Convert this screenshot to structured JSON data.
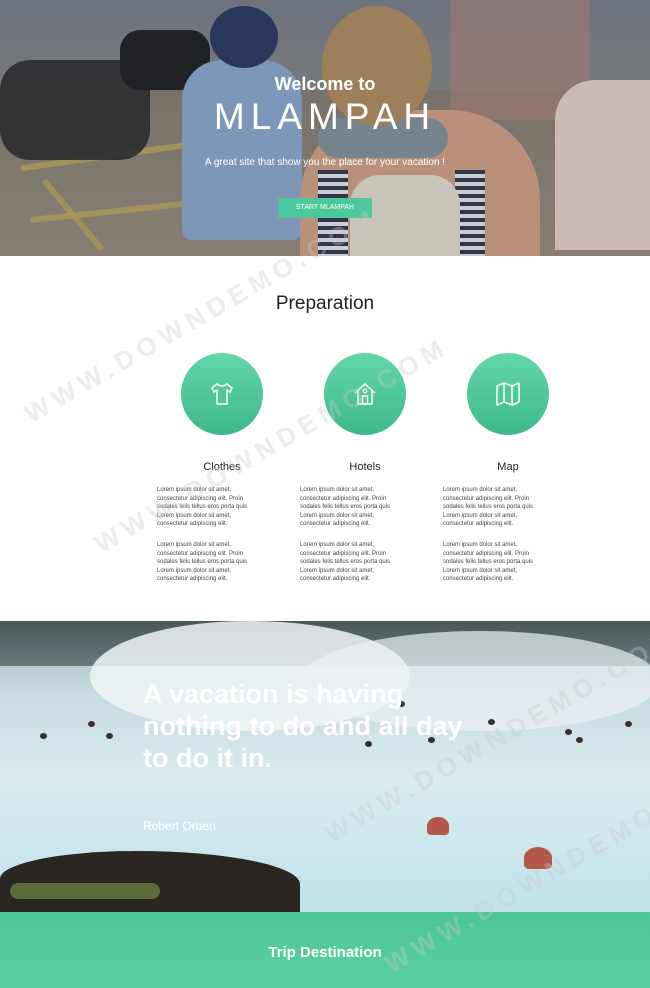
{
  "hero": {
    "welcome": "Welcome to",
    "brand": "MLAMPAH",
    "subtitle": "A great site that show you the place for your vacation !",
    "button_label": "START MLAMPAH"
  },
  "preparation": {
    "title": "Preparation",
    "features": [
      {
        "icon": "shirt-icon",
        "title": "Clothes",
        "para1": "Lorem ipsum dolor sit amet, consectetur adipiscing elit. Proin sodales felis tellus eros porta quis Lorem ipsum dolor sit amet, consectetur adipiscing elit.",
        "para2": "Lorem ipsum dolor sit amet, consectetur adipiscing elit. Proin sodales felis tellus eros porta quis Lorem ipsum dolor sit amet, consectetur adipiscing elit."
      },
      {
        "icon": "house-icon",
        "title": "Hotels",
        "para1": "Lorem ipsum dolor sit amet, consectetur adipiscing elit. Proin sodales felis tellus eros porta quis Lorem ipsum dolor sit amet, consectetur adipiscing elit.",
        "para2": "Lorem ipsum dolor sit amet, consectetur adipiscing elit. Proin sodales felis tellus eros porta quis Lorem ipsum dolor sit amet, consectetur adipiscing elit."
      },
      {
        "icon": "map-icon",
        "title": "Map",
        "para1": "Lorem ipsum dolor sit amet, consectetur adipiscing elit. Proin sodales felis tellus eros porta quis Lorem ipsum dolor sit amet, consectetur adipiscing elit.",
        "para2": "Lorem ipsum dolor sit amet, consectetur adipiscing elit. Proin sodales felis tellus eros porta quis Lorem ipsum dolor sit amet, consectetur adipiscing elit."
      }
    ]
  },
  "quote": {
    "text": "A vacation is having nothing to do and all day to do it in.",
    "author": "Robert Orben"
  },
  "footer": {
    "title": "Trip Destination"
  },
  "watermark": "WWW.DOWNDEMO.COM",
  "colors": {
    "accent": "#4dc89c",
    "text": "#222222",
    "white": "#ffffff"
  }
}
